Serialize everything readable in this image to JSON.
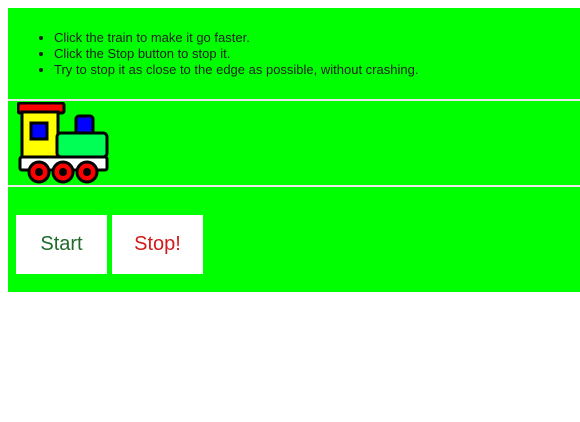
{
  "instructions": [
    "Click the train to make it go faster.",
    "Click the Stop button to stop it.",
    "Try to stop it as close to the edge as possible, without crashing."
  ],
  "buttons": {
    "start_label": "Start",
    "stop_label": "Stop!"
  },
  "icons": {
    "train": "train-icon"
  },
  "colors": {
    "background": "#00ff00",
    "start_text": "#1f6b2a",
    "stop_text": "#d11a1a"
  }
}
